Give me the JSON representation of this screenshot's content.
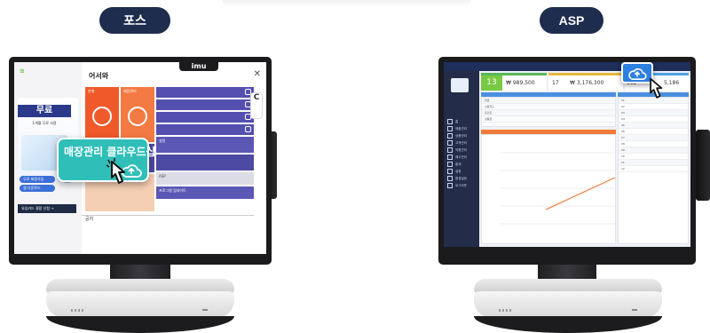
{
  "labels": {
    "pos": "포스",
    "asp": "ASP"
  },
  "pos_screen": {
    "brand": "imu",
    "title": "어서와",
    "banner_title": "무료",
    "banner_sub": "1개월 무료 사용",
    "sidebar_buttons": [
      "무료 회원가입",
      "앱 다운로드"
    ],
    "sidebar_footer": "유심카드 결합 신청 →",
    "notice": "공지",
    "tiles": {
      "sales": "판매",
      "order": "매장관리",
      "customer": "고객관리",
      "setting": "설정",
      "asp": "ASP",
      "program": "프로그램 업데이트"
    },
    "callout_text": "매장관리 클라우드샵"
  },
  "asp_screen": {
    "stats": [
      {
        "value": "13"
      },
      {
        "value": "₩ 989,500"
      },
      {
        "value": "17"
      },
      {
        "value": "₩ 3,176,300"
      },
      {
        "value": "112"
      },
      {
        "value": "5,186"
      }
    ],
    "menu": [
      "홈",
      "매출관리",
      "상품관리",
      "고객관리",
      "직원관리",
      "재고관리",
      "통계",
      "설정",
      "환경설정",
      "로그아웃"
    ],
    "panel_rows": [
      "현금",
      "신용카드",
      "포인트",
      "상품권",
      "기타"
    ],
    "table_rows": [
      "01",
      "02",
      "03",
      "04",
      "05",
      "06",
      "07",
      "08",
      "09",
      "10",
      "11",
      "12"
    ]
  },
  "colors": {
    "pill": "#1e2c4e",
    "callout": "#2fbfb8",
    "asp_highlight": "#2d7fe0",
    "pos_orange": "#f05a2b",
    "pos_purple": "#4d4aa3"
  },
  "icons": [
    "cloud-upload-icon",
    "pointer-hand-icon"
  ]
}
